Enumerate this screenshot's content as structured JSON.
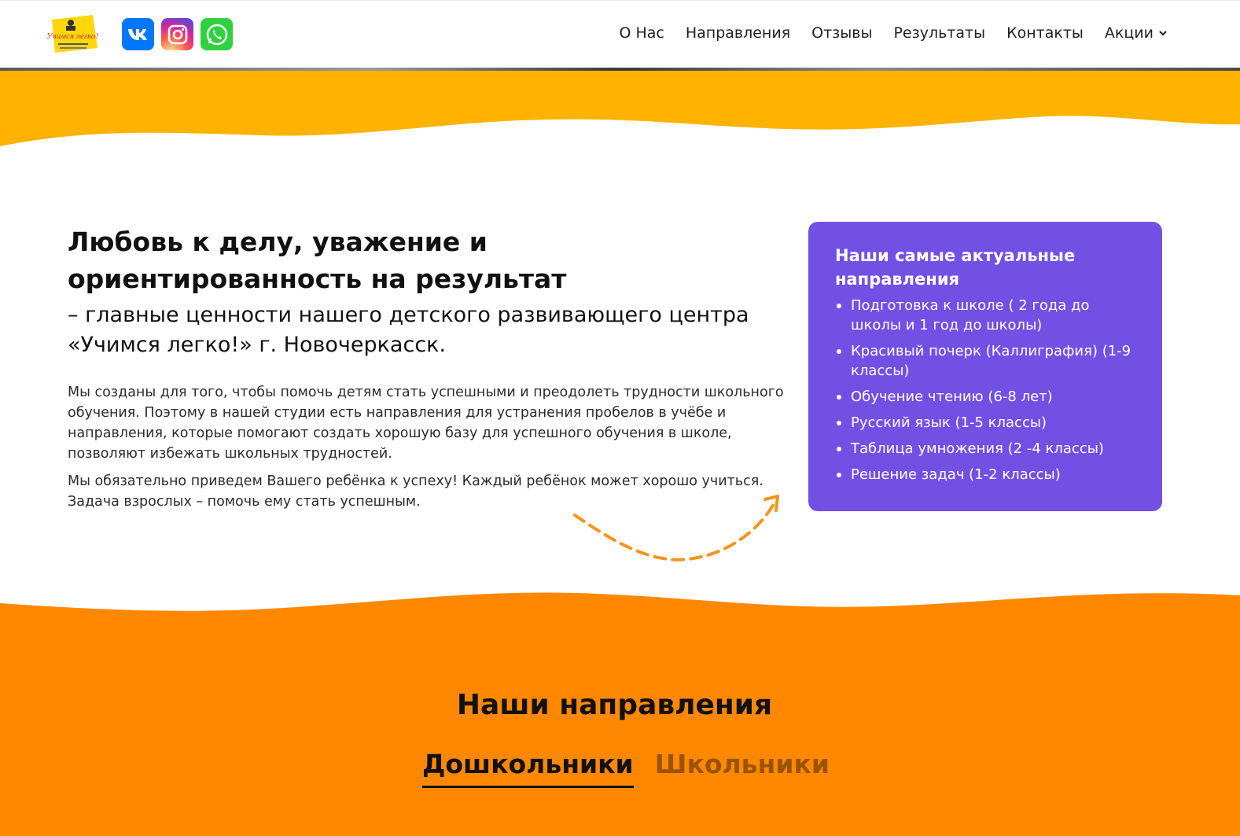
{
  "header": {
    "logo_text": "Учимся легко!",
    "nav": [
      {
        "label": "О Нас"
      },
      {
        "label": "Направления"
      },
      {
        "label": "Отзывы"
      },
      {
        "label": "Результаты"
      },
      {
        "label": "Контакты"
      },
      {
        "label": "Акции"
      }
    ]
  },
  "hero": {
    "headline": "Любовь к делу, уважение и ориентированность на результат",
    "subhead": "– главные ценности нашего детского развивающего центра «Учимся легко!» г. Новочеркасск.",
    "paragraph1": "Мы созданы для того, чтобы помочь детям стать успешными и преодолеть трудности школьного обучения. Поэтому в нашей студии есть направления для устранения пробелов в учёбе и направления, которые помогают создать хорошую базу для успешного обучения в школе, позволяют избежать школьных трудностей.",
    "paragraph2": "Мы обязательно приведем Вашего ребёнка к успеху! Каждый ребёнок может хорошо учиться. Задача взрослых – помочь ему стать успешным."
  },
  "card": {
    "title": "Наши самые актуальные направления",
    "items": [
      "Подготовка к школе ( 2 года до школы и 1 год до школы)",
      "Красивый почерк (Каллиграфия) (1-9 классы)",
      "Обучение чтению (6-8 лет)",
      "Русский язык (1-5 классы)",
      "Таблица умножения (2 -4 классы)",
      "Решение задач (1-2 классы)"
    ]
  },
  "directions": {
    "title": "Наши направления",
    "tabs": [
      {
        "label": "Дошкольники",
        "active": true
      },
      {
        "label": "Школьники",
        "active": false
      }
    ]
  },
  "colors": {
    "yellow_band": "#ffb300",
    "orange_band": "#ff8800",
    "card_purple": "#7250e4",
    "arrow": "#f7941d"
  },
  "icons": [
    "vk-icon",
    "instagram-icon",
    "whatsapp-icon",
    "chevron-down-icon",
    "dashed-arrow-icon"
  ]
}
